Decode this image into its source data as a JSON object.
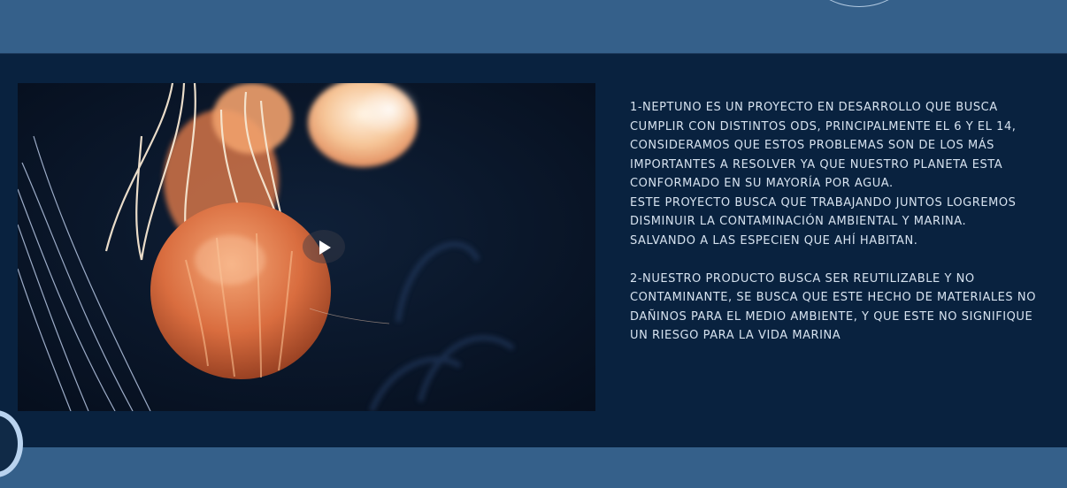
{
  "paragraph_1": {
    "line_1": "1-NEPTUNO ES UN PROYECTO EN DESARROLLO QUE BUSCA",
    "line_2": "CUMPLIR CON DISTINTOS ODS, PRINCIPALMENTE EL 6 Y EL 14,",
    "line_3": "CONSIDERAMOS QUE ESTOS PROBLEMAS SON DE LOS MÁS",
    "line_4": "IMPORTANTES A RESOLVER YA QUE NUESTRO PLANETA ESTA",
    "line_5": "CONFORMADO EN SU MAYORÍA POR AGUA.",
    "line_6": "ESTE PROYECTO BUSCA QUE TRABAJANDO JUNTOS LOGREMOS",
    "line_7": "DISMINUIR LA CONTAMINACIÓN AMBIENTAL Y MARINA.",
    "line_8": "SALVANDO A LAS ESPECIEN QUE AHÍ HABITAN."
  },
  "paragraph_2": {
    "line_1": "2-NUESTRO PRODUCTO BUSCA SER REUTILIZABLE Y NO",
    "line_2": "CONTAMINANTE, SE BUSCA QUE ESTE HECHO DE MATERIALES NO",
    "line_3": "DAÑINOS PARA EL MEDIO AMBIENTE, Y QUE ESTE NO SIGNIFIQUE",
    "line_4": "UN RIESGO PARA LA VIDA MARINA"
  },
  "icons": {
    "play": "play-icon"
  },
  "colors": {
    "header_band": "#35608a",
    "main_background": "#09223f",
    "text": "#d6e2ef",
    "ring": "#b9d3ef"
  }
}
